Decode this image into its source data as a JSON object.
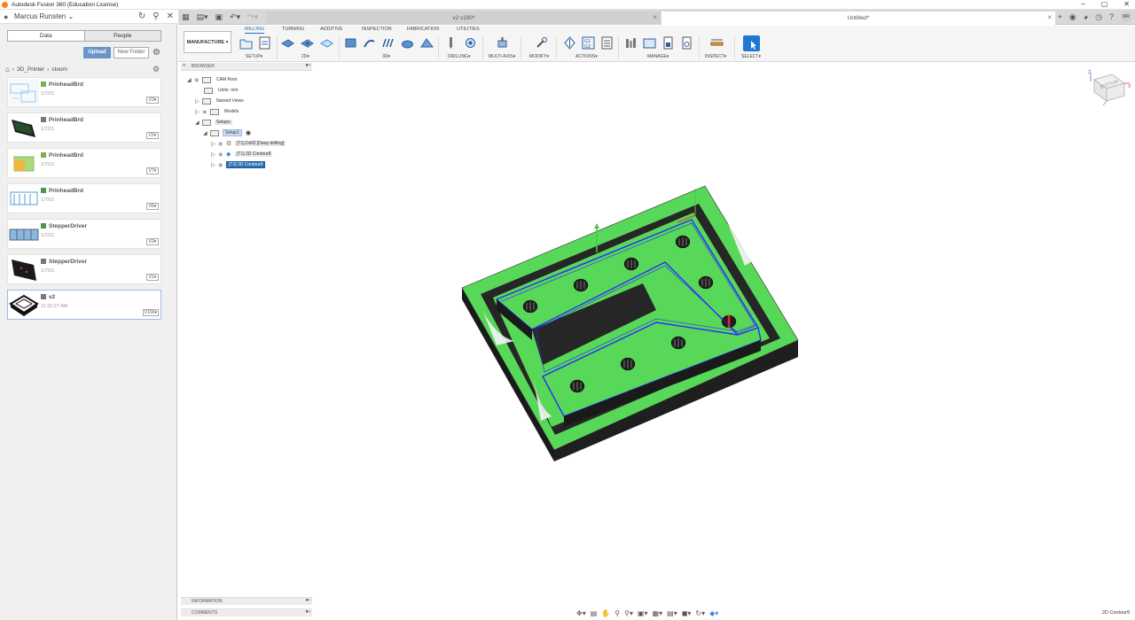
{
  "window": {
    "title": "Autodesk Fusion 360 (Education License)",
    "controls": [
      "–",
      "▢",
      "✕"
    ]
  },
  "user": {
    "name": "Marcus Runsten"
  },
  "data_panel": {
    "tabs": [
      {
        "label": "Data",
        "active": true
      },
      {
        "label": "People",
        "active": false
      }
    ],
    "upload_label": "Upload",
    "new_folder_label": "New Folder",
    "breadcrumb": [
      "3D_Printer",
      "stoom"
    ],
    "files": [
      {
        "name": "PrinheadBrd",
        "date": "1/7/21",
        "version": "V3",
        "type_color": "#7bb24c"
      },
      {
        "name": "PrinheadBrd",
        "date": "1/7/21",
        "version": "V2",
        "type_color": "#777777"
      },
      {
        "name": "PrinheadBrd",
        "date": "1/7/21",
        "version": "V7",
        "type_color": "#7bb24c"
      },
      {
        "name": "PrinheadBrd",
        "date": "1/7/21",
        "version": "V6",
        "type_color": "#4b9a4b"
      },
      {
        "name": "StepperDriver",
        "date": "1/7/21",
        "version": "V2",
        "type_color": "#4b9a4b"
      },
      {
        "name": "StepperDriver",
        "date": "1/7/21",
        "version": "V1",
        "type_color": "#777777"
      },
      {
        "name": "v2",
        "date": "11:32:27 AM",
        "version": "V190",
        "type_color": "#777777"
      }
    ]
  },
  "doc_tabs": [
    {
      "label": "v2 v190*",
      "active": false
    },
    {
      "label": "Untitled*",
      "active": true
    }
  ],
  "avatar_initials": "MR",
  "ribbon": {
    "workspace": "MANUFACTURE",
    "tabs": [
      {
        "label": "MILLING",
        "active": true
      },
      {
        "label": "TURNING",
        "active": false
      },
      {
        "label": "ADDITIVE",
        "active": false
      },
      {
        "label": "INSPECTION",
        "active": false
      },
      {
        "label": "FABRICATION",
        "active": false
      },
      {
        "label": "UTILITIES",
        "active": false
      }
    ],
    "groups": [
      "SETUP",
      "2D",
      "3D",
      "DRILLING",
      "MULTI-AXIS",
      "MODIFY",
      "ACTIONS",
      "MANAGE",
      "INSPECT",
      "SELECT"
    ],
    "accent": "#1e6fc2"
  },
  "browser": {
    "title": "BROWSER",
    "nodes": [
      {
        "label": "CAM Root"
      },
      {
        "label": "Units: mm"
      },
      {
        "label": "Named Views"
      },
      {
        "label": "Models"
      },
      {
        "label": "Setups"
      },
      {
        "label": "Setup1"
      },
      {
        "label": "[T1] Drill2 [Deep drilling]"
      },
      {
        "label": "[T1] 2D Contour8"
      },
      {
        "label": "[T2] 2D Contour9"
      }
    ]
  },
  "bottom_panels": [
    "INFORMATION",
    "COMMENTS"
  ],
  "viewcube": {
    "face": "BOTTOM"
  },
  "status": "2D Contour9",
  "model_colors": {
    "body": "#58d858",
    "outline": "#2a2a2a",
    "toolpath": "#2b2bff",
    "marker": "#ff2020"
  }
}
